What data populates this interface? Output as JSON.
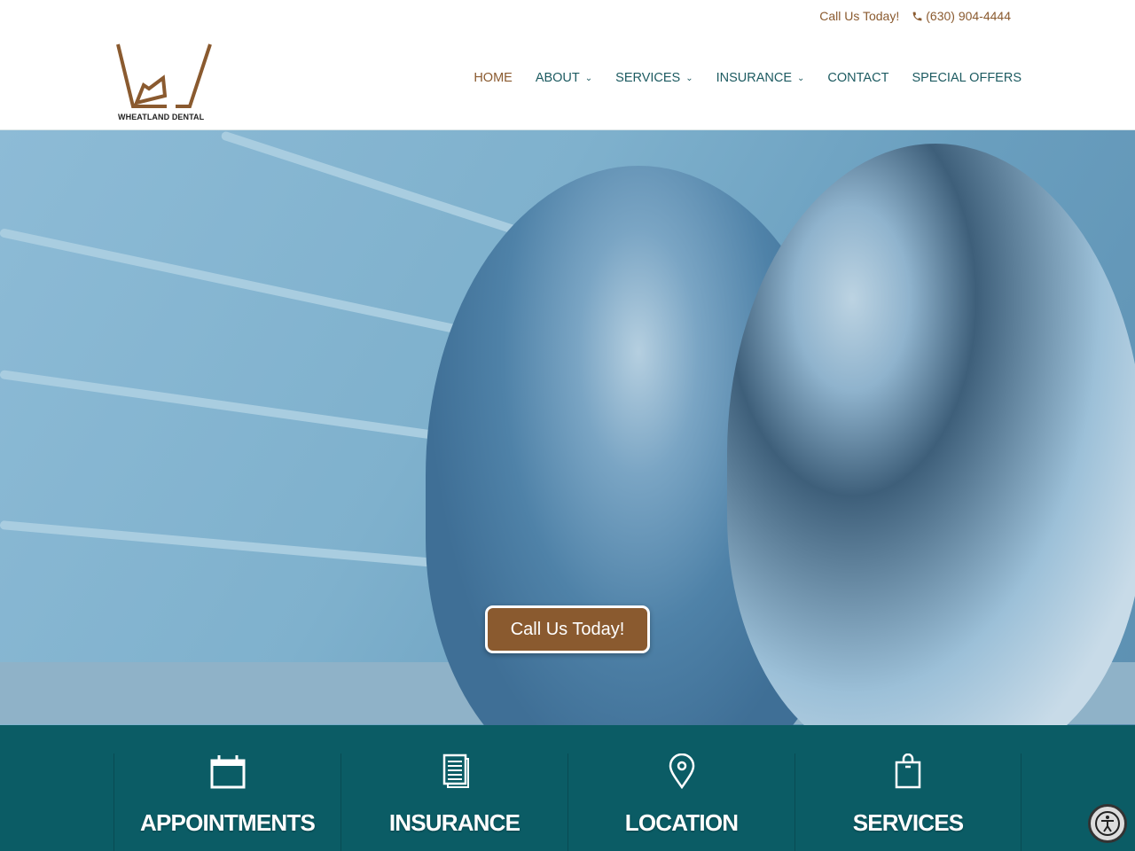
{
  "topbar": {
    "call_label": "Call Us Today!",
    "phone": "(630) 904-4444",
    "icon": "phone-icon"
  },
  "logo": {
    "text": "WHEATLAND DENTAL"
  },
  "nav": [
    {
      "label": "HOME",
      "active": true
    },
    {
      "label": "ABOUT",
      "dropdown": true
    },
    {
      "label": "SERVICES",
      "dropdown": true
    },
    {
      "label": "INSURANCE",
      "dropdown": true
    },
    {
      "label": "CONTACT"
    },
    {
      "label": "SPECIAL OFFERS"
    }
  ],
  "hero": {
    "cta_label": "Call Us Today!"
  },
  "features": [
    {
      "label": "APPOINTMENTS",
      "icon": "calendar-icon"
    },
    {
      "label": "INSURANCE",
      "icon": "document-icon"
    },
    {
      "label": "LOCATION",
      "icon": "map-pin-icon"
    },
    {
      "label": "SERVICES",
      "icon": "shopping-bag-icon"
    }
  ],
  "colors": {
    "brand_brown": "#8a5a2f",
    "teal": "#0b5c65",
    "nav_teal": "#1d5b61"
  },
  "accessibility": {
    "icon": "accessibility-icon"
  }
}
